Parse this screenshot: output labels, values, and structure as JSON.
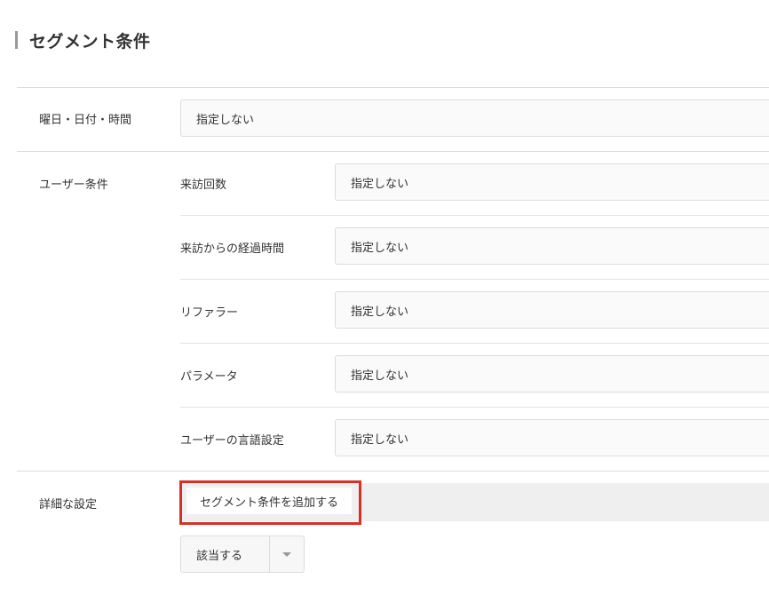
{
  "section": {
    "title": "セグメント条件"
  },
  "datetime": {
    "label": "曜日・日付・時間",
    "value": "指定しない"
  },
  "user_conditions": {
    "label": "ユーザー条件",
    "items": [
      {
        "label": "来訪回数",
        "value": "指定しない"
      },
      {
        "label": "来訪からの経過時間",
        "value": "指定しない"
      },
      {
        "label": "リファラー",
        "value": "指定しない"
      },
      {
        "label": "パラメータ",
        "value": "指定しない"
      },
      {
        "label": "ユーザーの言語設定",
        "value": "指定しない"
      }
    ]
  },
  "advanced": {
    "label": "詳細な設定",
    "add_button": "セグメント条件を追加する",
    "match_select": {
      "value": "該当する",
      "icon": "caret-down-icon"
    }
  },
  "colors": {
    "highlight": "#d93025",
    "band": "#efefef",
    "border": "#dddddd"
  }
}
